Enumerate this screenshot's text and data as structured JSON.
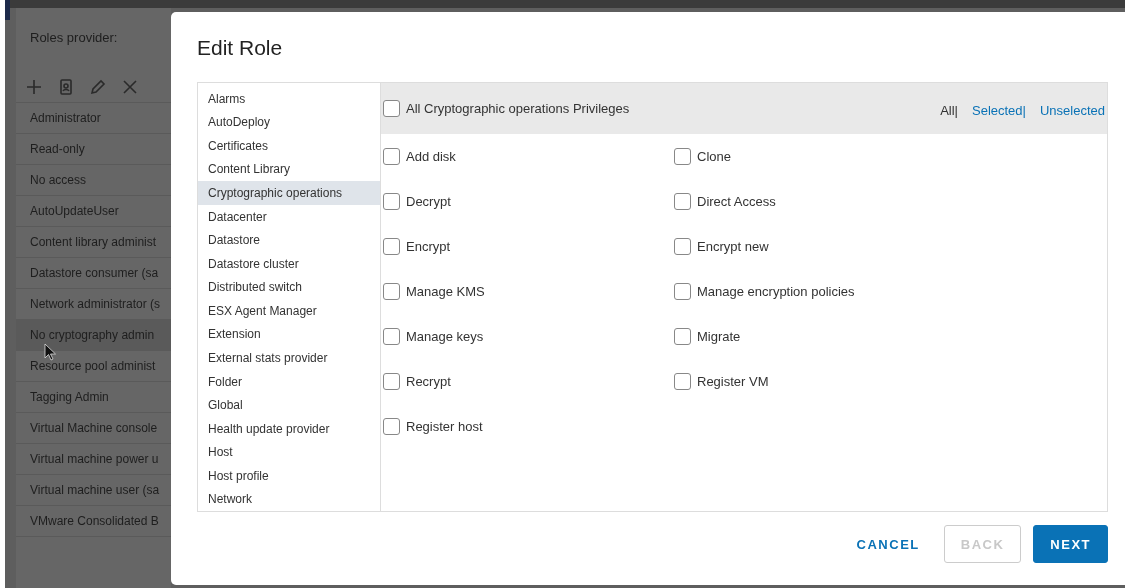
{
  "roles_panel": {
    "title": "Roles provider:",
    "toolbar": [
      {
        "kind": "add"
      },
      {
        "kind": "clone"
      },
      {
        "kind": "edit"
      },
      {
        "kind": "delete"
      }
    ],
    "roles": [
      {
        "label": "Administrator",
        "selected": false
      },
      {
        "label": "Read-only",
        "selected": false
      },
      {
        "label": "No access",
        "selected": false
      },
      {
        "label": "AutoUpdateUser",
        "selected": false
      },
      {
        "label": "Content library administ",
        "selected": false
      },
      {
        "label": "Datastore consumer (sa",
        "selected": false
      },
      {
        "label": "Network administrator (s",
        "selected": false
      },
      {
        "label": "No cryptography admin",
        "selected": true
      },
      {
        "label": "Resource pool administ",
        "selected": false
      },
      {
        "label": "Tagging Admin",
        "selected": false
      },
      {
        "label": "Virtual Machine console",
        "selected": false
      },
      {
        "label": "Virtual machine power u",
        "selected": false
      },
      {
        "label": "Virtual machine user (sa",
        "selected": false
      },
      {
        "label": "VMware Consolidated B",
        "selected": false
      }
    ]
  },
  "dialog": {
    "title": "Edit Role",
    "categories": [
      {
        "label": "Alarms",
        "selected": false
      },
      {
        "label": "AutoDeploy",
        "selected": false
      },
      {
        "label": "Certificates",
        "selected": false
      },
      {
        "label": "Content Library",
        "selected": false
      },
      {
        "label": "Cryptographic operations",
        "selected": true
      },
      {
        "label": "Datacenter",
        "selected": false
      },
      {
        "label": "Datastore",
        "selected": false
      },
      {
        "label": "Datastore cluster",
        "selected": false
      },
      {
        "label": "Distributed switch",
        "selected": false
      },
      {
        "label": "ESX Agent Manager",
        "selected": false
      },
      {
        "label": "Extension",
        "selected": false
      },
      {
        "label": "External stats provider",
        "selected": false
      },
      {
        "label": "Folder",
        "selected": false
      },
      {
        "label": "Global",
        "selected": false
      },
      {
        "label": "Health update provider",
        "selected": false
      },
      {
        "label": "Host",
        "selected": false
      },
      {
        "label": "Host profile",
        "selected": false
      },
      {
        "label": "Network",
        "selected": false
      }
    ],
    "all_privileges": {
      "label": "All Cryptographic operations Privileges",
      "checked": false
    },
    "filters": [
      {
        "label": "All|",
        "selected": true
      },
      {
        "label": "Selected|",
        "selected": false
      },
      {
        "label": "Unselected",
        "selected": false
      }
    ],
    "privileges": [
      {
        "label": "Add disk",
        "checked": false
      },
      {
        "label": "Clone",
        "checked": false
      },
      {
        "label": "Decrypt",
        "checked": false
      },
      {
        "label": "Direct Access",
        "checked": false
      },
      {
        "label": "Encrypt",
        "checked": false
      },
      {
        "label": "Encrypt new",
        "checked": false
      },
      {
        "label": "Manage KMS",
        "checked": false
      },
      {
        "label": "Manage encryption policies",
        "checked": false
      },
      {
        "label": "Manage keys",
        "checked": false
      },
      {
        "label": "Migrate",
        "checked": false
      },
      {
        "label": "Recrypt",
        "checked": false
      },
      {
        "label": "Register VM",
        "checked": false
      },
      {
        "label": "Register host",
        "checked": false
      }
    ],
    "buttons": [
      {
        "label": "CANCEL",
        "kind": "link",
        "disabled": false
      },
      {
        "label": "BACK",
        "kind": "outline",
        "disabled": true
      },
      {
        "label": "NEXT",
        "kind": "primary",
        "disabled": false
      }
    ]
  }
}
